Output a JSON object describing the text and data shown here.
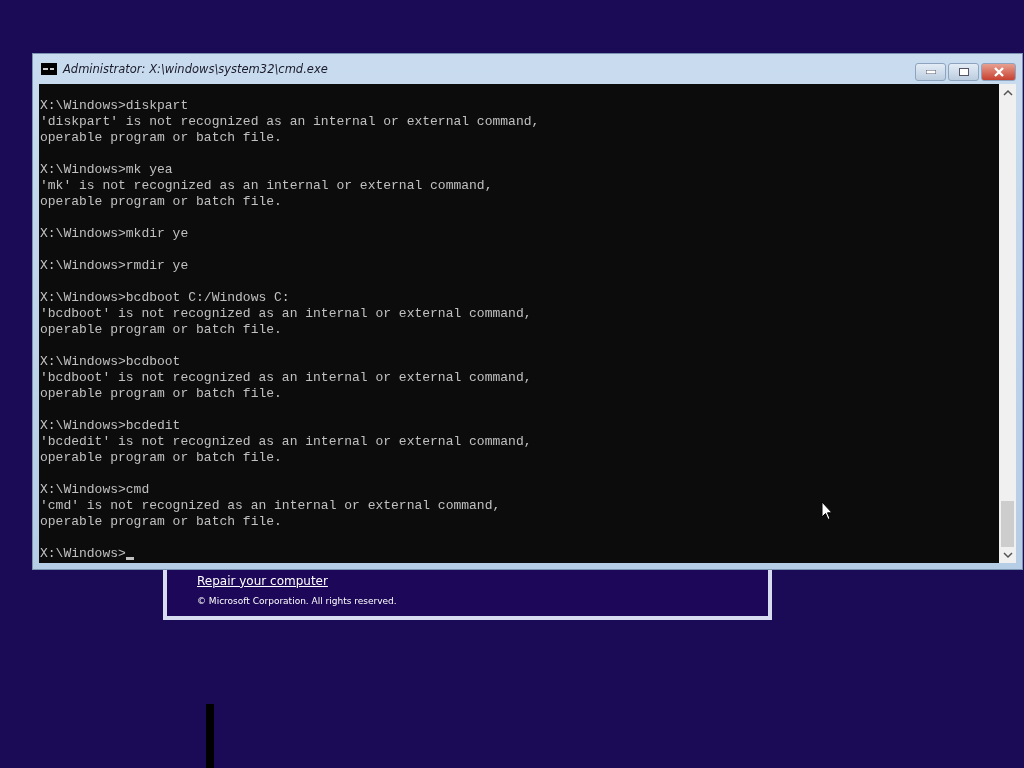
{
  "window": {
    "title": "Administrator: X:\\windows\\system32\\cmd.exe"
  },
  "console": {
    "blocks": [
      {
        "lines": [
          "X:\\Windows>diskpart",
          "'diskpart' is not recognized as an internal or external command,",
          "operable program or batch file."
        ]
      },
      {
        "lines": [
          "X:\\Windows>mk yea",
          "'mk' is not recognized as an internal or external command,",
          "operable program or batch file."
        ]
      },
      {
        "lines": [
          "X:\\Windows>mkdir ye"
        ]
      },
      {
        "lines": [
          "X:\\Windows>rmdir ye"
        ]
      },
      {
        "lines": [
          "X:\\Windows>bcdboot C:/Windows C:",
          "'bcdboot' is not recognized as an internal or external command,",
          "operable program or batch file."
        ]
      },
      {
        "lines": [
          "X:\\Windows>bcdboot",
          "'bcdboot' is not recognized as an internal or external command,",
          "operable program or batch file."
        ]
      },
      {
        "lines": [
          "X:\\Windows>bcdedit",
          "'bcdedit' is not recognized as an internal or external command,",
          "operable program or batch file."
        ]
      },
      {
        "lines": [
          "X:\\Windows>cmd",
          "'cmd' is not recognized as an internal or external command,",
          "operable program or batch file."
        ]
      }
    ],
    "prompt": "X:\\Windows>"
  },
  "setup_dialog": {
    "link": "Repair your computer",
    "copyright": "© Microsoft Corporation. All rights reserved."
  }
}
